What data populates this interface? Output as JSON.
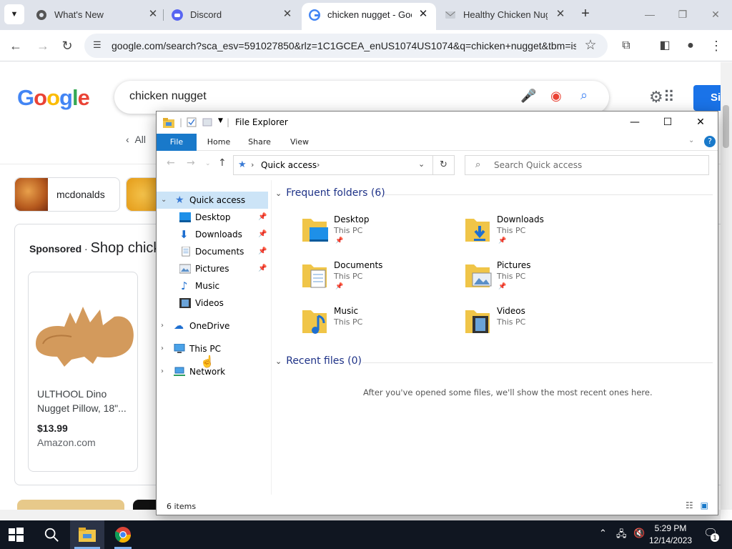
{
  "browser": {
    "tabs": [
      {
        "title": "What's New",
        "icon": "chrome-icon"
      },
      {
        "title": "Discord",
        "icon": "discord-icon"
      },
      {
        "title": "chicken nugget - Goo",
        "icon": "google-icon",
        "active": true
      },
      {
        "title": "Healthy Chicken Nugg",
        "icon": "mail-icon"
      }
    ],
    "url": "google.com/search?sca_esv=591027850&rlz=1C1GCEA_enUS1074US1074&q=chicken+nugget&tbm=is..."
  },
  "google": {
    "query": "chicken nugget",
    "all_label": "All",
    "signin_label": "Si",
    "chips": [
      {
        "label": "mcdonalds"
      }
    ],
    "sponsored_label": "Sponsored",
    "sponsored_title": "Shop chick",
    "product": {
      "title": "ULTHOOL Dino Nugget Pillow, 18\"...",
      "price": "$13.99",
      "seller": "Amazon.com"
    }
  },
  "explorer": {
    "title": "File Explorer",
    "ribbon_tabs": [
      "File",
      "Home",
      "Share",
      "View"
    ],
    "address": "Quick access",
    "search_placeholder": "Search Quick access",
    "nav": {
      "quick_access": "Quick access",
      "items": [
        "Desktop",
        "Downloads",
        "Documents",
        "Pictures",
        "Music",
        "Videos"
      ],
      "onedrive": "OneDrive",
      "this_pc": "This PC",
      "network": "Network"
    },
    "frequent_header": "Frequent folders (6)",
    "folders": [
      {
        "name": "Desktop",
        "location": "This PC",
        "pinned": true
      },
      {
        "name": "Downloads",
        "location": "This PC",
        "pinned": true
      },
      {
        "name": "Documents",
        "location": "This PC",
        "pinned": true
      },
      {
        "name": "Pictures",
        "location": "This PC",
        "pinned": true
      },
      {
        "name": "Music",
        "location": "This PC",
        "pinned": false
      },
      {
        "name": "Videos",
        "location": "This PC",
        "pinned": false
      }
    ],
    "recent_header": "Recent files (0)",
    "recent_empty": "After you've opened some files, we'll show the most recent ones here.",
    "status": "6 items"
  },
  "taskbar": {
    "time": "5:29 PM",
    "date": "12/14/2023",
    "notification_count": "1"
  }
}
